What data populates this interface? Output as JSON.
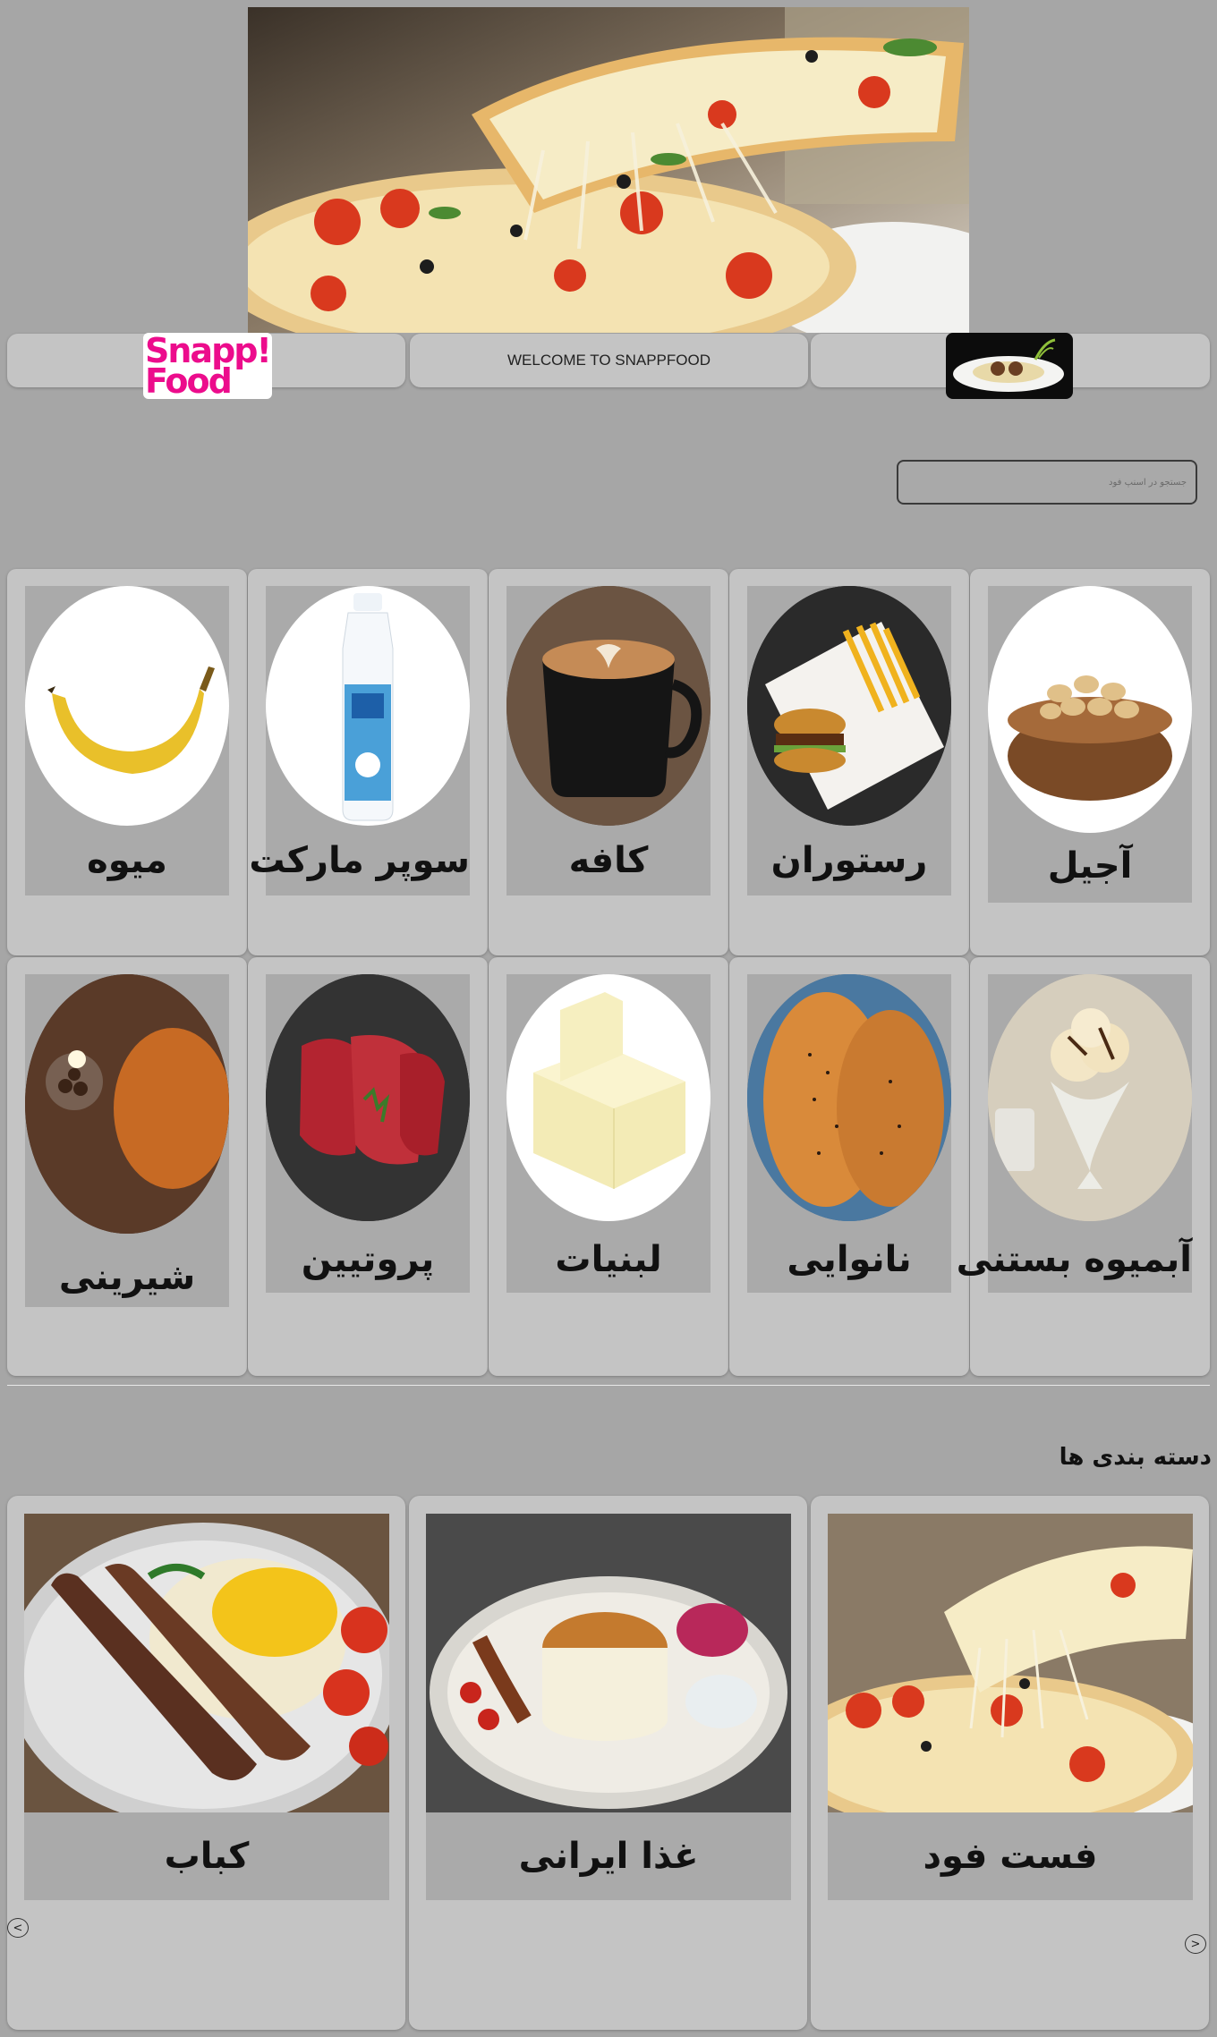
{
  "header": {
    "logo_line1": "Snapp!",
    "logo_line2": "Food",
    "welcome": "WELCOME TO SNAPPFOOD"
  },
  "search": {
    "placeholder": "جستجو در اسنپ فود"
  },
  "categories_row1": [
    {
      "label": "میوه",
      "icon": "banana"
    },
    {
      "label": "سوپر مارکت",
      "icon": "milk-bottle"
    },
    {
      "label": "کافه",
      "icon": "coffee-cup"
    },
    {
      "label": "رستوران",
      "icon": "burger-fries"
    },
    {
      "label": "آجیل",
      "icon": "pistachio-bowl"
    }
  ],
  "categories_row2": [
    {
      "label": "شیرینی",
      "icon": "cake"
    },
    {
      "label": "پروتیین",
      "icon": "raw-steak"
    },
    {
      "label": "لبنیات",
      "icon": "cheese"
    },
    {
      "label": "نانوایی",
      "icon": "bread"
    },
    {
      "label": "آبمیوه بستنی",
      "icon": "ice-cream"
    }
  ],
  "section": {
    "title": "دسته بندی ها"
  },
  "featured": [
    {
      "label": "کباب",
      "icon": "kebab-plate"
    },
    {
      "label": "غذا ایرانی",
      "icon": "persian-plate"
    },
    {
      "label": "فست فود",
      "icon": "pizza"
    }
  ],
  "carousel": {
    "prev": "<",
    "next": ">"
  },
  "colors": {
    "page_bg": "#a6a6a6",
    "card_bg": "#c4c4c4",
    "brand_pink": "#ec0c8c"
  }
}
